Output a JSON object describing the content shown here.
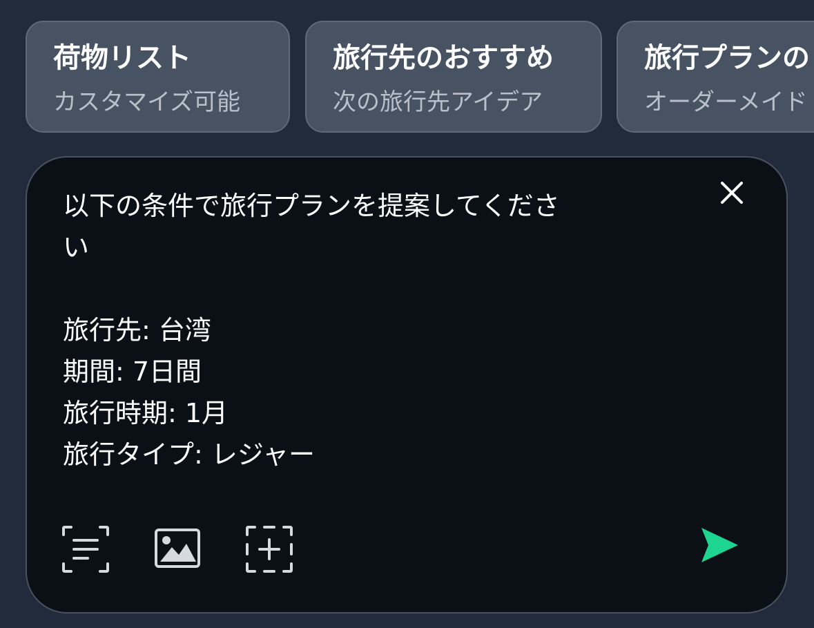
{
  "suggestions": [
    {
      "title": "荷物リスト",
      "subtitle": "カスタマイズ可能"
    },
    {
      "title": "旅行先のおすすめ",
      "subtitle": "次の旅行先アイデア"
    },
    {
      "title": "旅行プランの",
      "subtitle": "オーダーメイド"
    }
  ],
  "composer": {
    "text": "以下の条件で旅行プランを提案してくださ\nい\n\n旅行先: 台湾\n期間: 7日間\n旅行時期: 1月\n旅行タイプ: レジャー"
  },
  "icons": {
    "close": "close-icon",
    "text_scan": "text-scan-icon",
    "image": "image-icon",
    "add_frame": "add-frame-icon",
    "send": "send-icon"
  },
  "colors": {
    "background": "#212b3c",
    "chip": "#475262",
    "composer": "#0b1017",
    "send_accent": "#1ed491"
  }
}
